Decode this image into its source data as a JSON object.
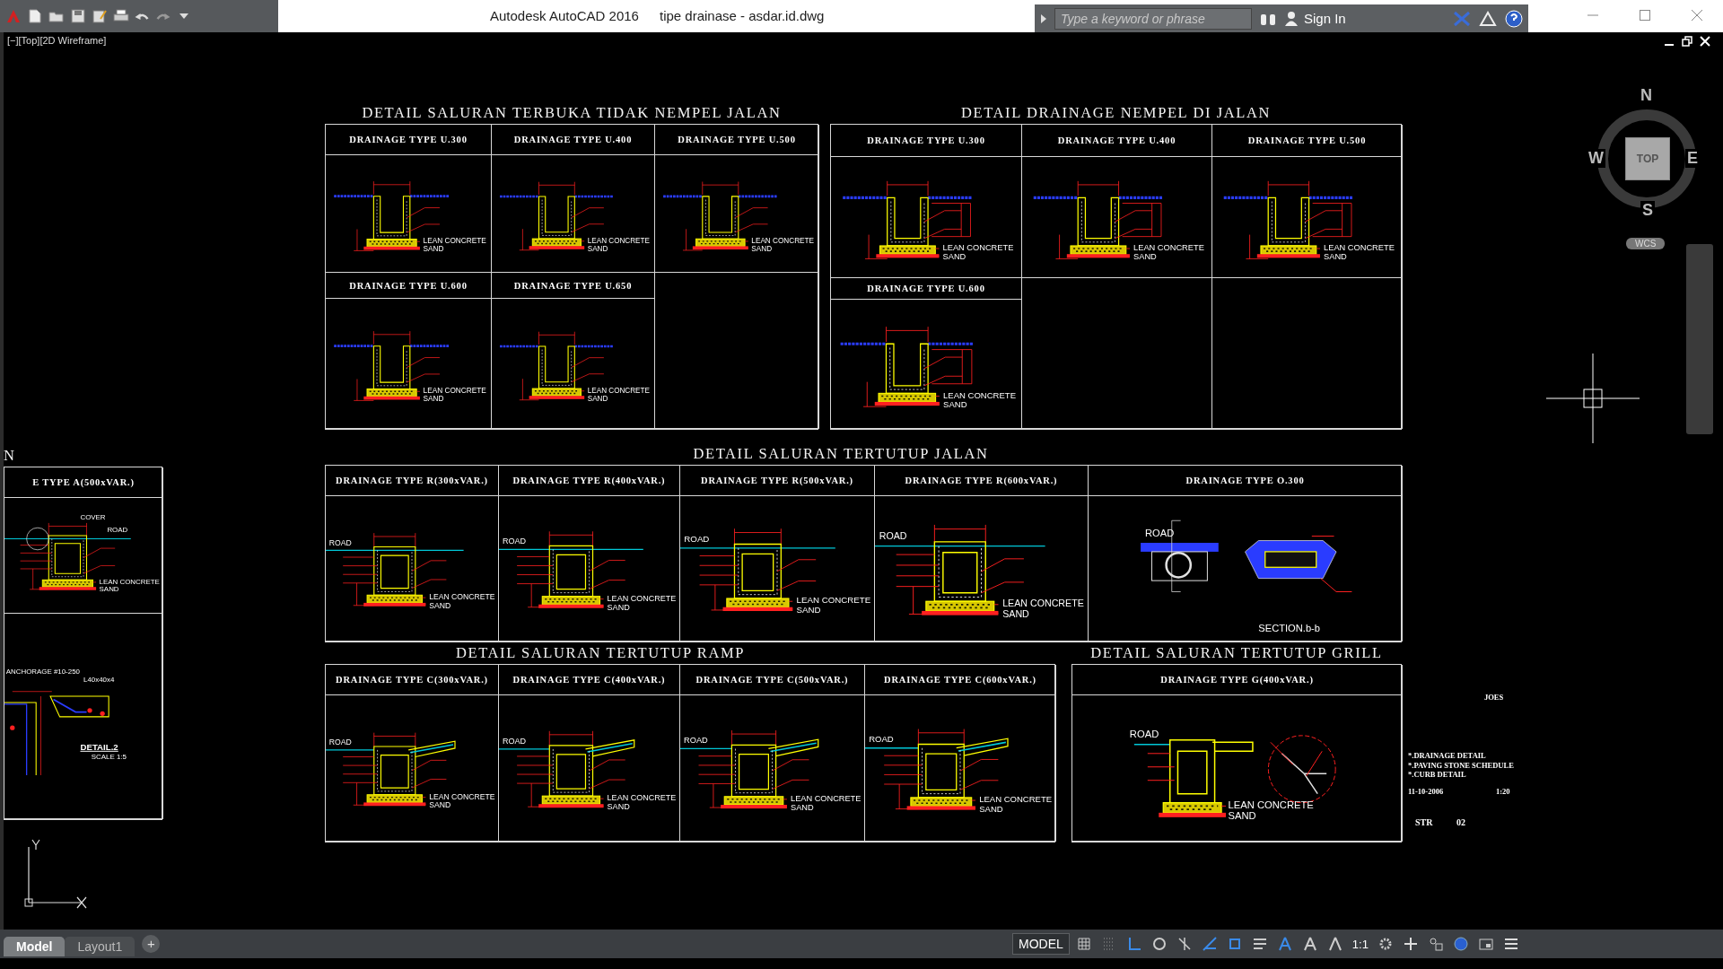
{
  "title_bar": {
    "app": "Autodesk AutoCAD 2016",
    "file": "tipe drainase - asdar.id.dwg",
    "search": {
      "placeholder": "Type a keyword or phrase"
    },
    "sign_in": "Sign In"
  },
  "viewport_label": "[−][Top][2D Wireframe]",
  "viewcube": {
    "top": "TOP",
    "north": "N",
    "south": "S",
    "east": "E",
    "west": "W",
    "wcs": "WCS"
  },
  "sheets": [
    {
      "title": "DETAIL SALURAN TERBUKA TIDAK NEMPEL JALAN",
      "rows": [
        {
          "cells": [
            {
              "heading": "DRAINAGE TYPE U.300",
              "kind": "open-u",
              "labels": [
                "LEAN CONCRETE",
                "SAND"
              ]
            },
            {
              "heading": "DRAINAGE TYPE U.400",
              "kind": "open-u",
              "labels": [
                "LEAN CONCRETE",
                "SAND"
              ]
            },
            {
              "heading": "DRAINAGE TYPE U.500",
              "kind": "open-u",
              "labels": [
                "LEAN CONCRETE",
                "SAND"
              ]
            }
          ]
        },
        {
          "cells": [
            {
              "heading": "DRAINAGE TYPE U.600",
              "kind": "open-u",
              "labels": [
                "LEAN CONCRETE",
                "SAND"
              ]
            },
            {
              "heading": "DRAINAGE TYPE U.650",
              "kind": "open-u",
              "labels": [
                "LEAN CONCRETE",
                "SAND"
              ]
            },
            {
              "kind": "empty"
            }
          ]
        }
      ]
    },
    {
      "title": "DETAIL DRAINAGE NEMPEL DI JALAN",
      "rows": [
        {
          "cells": [
            {
              "heading": "DRAINAGE TYPE U.300",
              "kind": "road-u",
              "labels": [
                "LEAN CONCRETE",
                "SAND"
              ]
            },
            {
              "heading": "DRAINAGE TYPE U.400",
              "kind": "road-u",
              "labels": [
                "LEAN CONCRETE",
                "SAND"
              ]
            },
            {
              "heading": "DRAINAGE TYPE U.500",
              "kind": "road-u",
              "labels": [
                "LEAN CONCRETE",
                "SAND"
              ]
            }
          ]
        },
        {
          "cells": [
            {
              "heading": "DRAINAGE TYPE U.600",
              "kind": "road-u",
              "labels": [
                "LEAN CONCRETE",
                "SAND"
              ]
            },
            {
              "kind": "empty"
            },
            {
              "kind": "empty"
            }
          ]
        }
      ]
    },
    {
      "title": "DETAIL SALURAN TERTUTUP JALAN",
      "rows": [
        {
          "cells": [
            {
              "heading": "DRAINAGE TYPE R(300xVAR.)",
              "kind": "box",
              "labels": [
                "ROAD",
                "LEAN CONCRETE",
                "SAND"
              ]
            },
            {
              "heading": "DRAINAGE TYPE R(400xVAR.)",
              "kind": "box",
              "labels": [
                "ROAD",
                "LEAN CONCRETE",
                "SAND"
              ]
            },
            {
              "heading": "DRAINAGE TYPE R(500xVAR.)",
              "kind": "box",
              "labels": [
                "ROAD",
                "LEAN CONCRETE",
                "SAND"
              ]
            },
            {
              "heading": "DRAINAGE TYPE R(600xVAR.)",
              "kind": "box",
              "labels": [
                "ROAD",
                "LEAN CONCRETE",
                "SAND"
              ]
            },
            {
              "heading": "DRAINAGE TYPE O.300",
              "kind": "pipe",
              "labels": [
                "ROAD",
                "SECTION.b-b"
              ]
            }
          ]
        }
      ]
    },
    {
      "title": "DETAIL SALURAN TERTUTUP RAMP",
      "rows": [
        {
          "cells": [
            {
              "heading": "DRAINAGE TYPE C(300xVAR.)",
              "kind": "ramp",
              "labels": [
                "ROAD",
                "LEAN CONCRETE",
                "SAND"
              ]
            },
            {
              "heading": "DRAINAGE TYPE C(400xVAR.)",
              "kind": "ramp",
              "labels": [
                "ROAD",
                "LEAN CONCRETE",
                "SAND"
              ]
            },
            {
              "heading": "DRAINAGE TYPE C(500xVAR.)",
              "kind": "ramp",
              "labels": [
                "ROAD",
                "LEAN CONCRETE",
                "SAND"
              ]
            },
            {
              "heading": "DRAINAGE TYPE C(600xVAR.)",
              "kind": "ramp",
              "labels": [
                "ROAD",
                "LEAN CONCRETE",
                "SAND"
              ]
            }
          ]
        }
      ]
    },
    {
      "title": "DETAIL SALURAN TERTUTUP GRILL",
      "rows": [
        {
          "cells": [
            {
              "heading": "DRAINAGE TYPE G(400xVAR.)",
              "kind": "grill",
              "labels": [
                "ROAD",
                "LEAN CONCRETE",
                "SAND"
              ]
            }
          ]
        }
      ]
    },
    {
      "title": "N",
      "rows": [
        {
          "cells": [
            {
              "heading": "E TYPE A(500xVAR.)",
              "kind": "box-cover",
              "labels": [
                "COVER",
                "ROAD",
                "LEAN CONCRETE",
                "SAND"
              ]
            }
          ]
        },
        {
          "cells": [
            {
              "kind": "detail-2",
              "labels": [
                "ANCHORAGE #10-250",
                "L40x40x4",
                "DETAIL.2",
                "SCALE 1:5"
              ]
            }
          ]
        }
      ]
    }
  ],
  "notes": {
    "code": "JOES",
    "items": [
      "*.DRAINAGE DETAIL",
      "*.PAVING STONE SCHEDULE",
      "*.CURB DETAIL"
    ],
    "date": "11-10-2006",
    "scale": "1:20",
    "sheet_code": "STR",
    "sheet_no": "02"
  },
  "status_bar": {
    "tabs": [
      {
        "label": "Model",
        "selected": true
      },
      {
        "label": "Layout1",
        "selected": false
      }
    ],
    "add": "+",
    "model": "MODEL",
    "annotation_scale": "1:1"
  }
}
